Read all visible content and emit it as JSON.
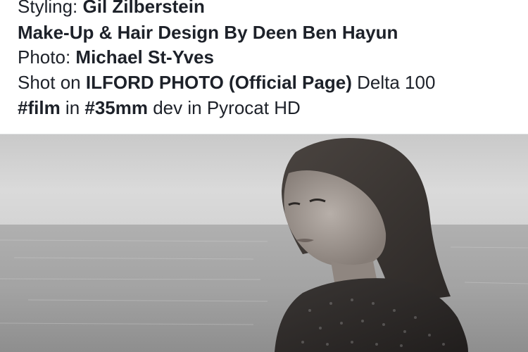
{
  "caption": {
    "line1": {
      "prefix": "Styling: ",
      "name": "Gil Zilberstein"
    },
    "line2": {
      "text": "Make-Up & Hair Design By Deen Ben Hayun"
    },
    "line3": {
      "prefix": "Photo: ",
      "name": "Michael St-Yves"
    },
    "line4": {
      "prefix": "Shot on ",
      "page": "ILFORD PHOTO (Official Page)",
      "suffix": " Delta 100"
    },
    "line5": {
      "tag1": "#film",
      "mid1": " in ",
      "tag2": "#35mm",
      "mid2": " dev in Pyrocat HD"
    }
  },
  "photo": {
    "subject": "black-and-white portrait of a woman looking over her shoulder by the sea"
  },
  "colors": {
    "text": "#1d2129",
    "background": "#ffffff",
    "separator": "#dddfe2"
  }
}
